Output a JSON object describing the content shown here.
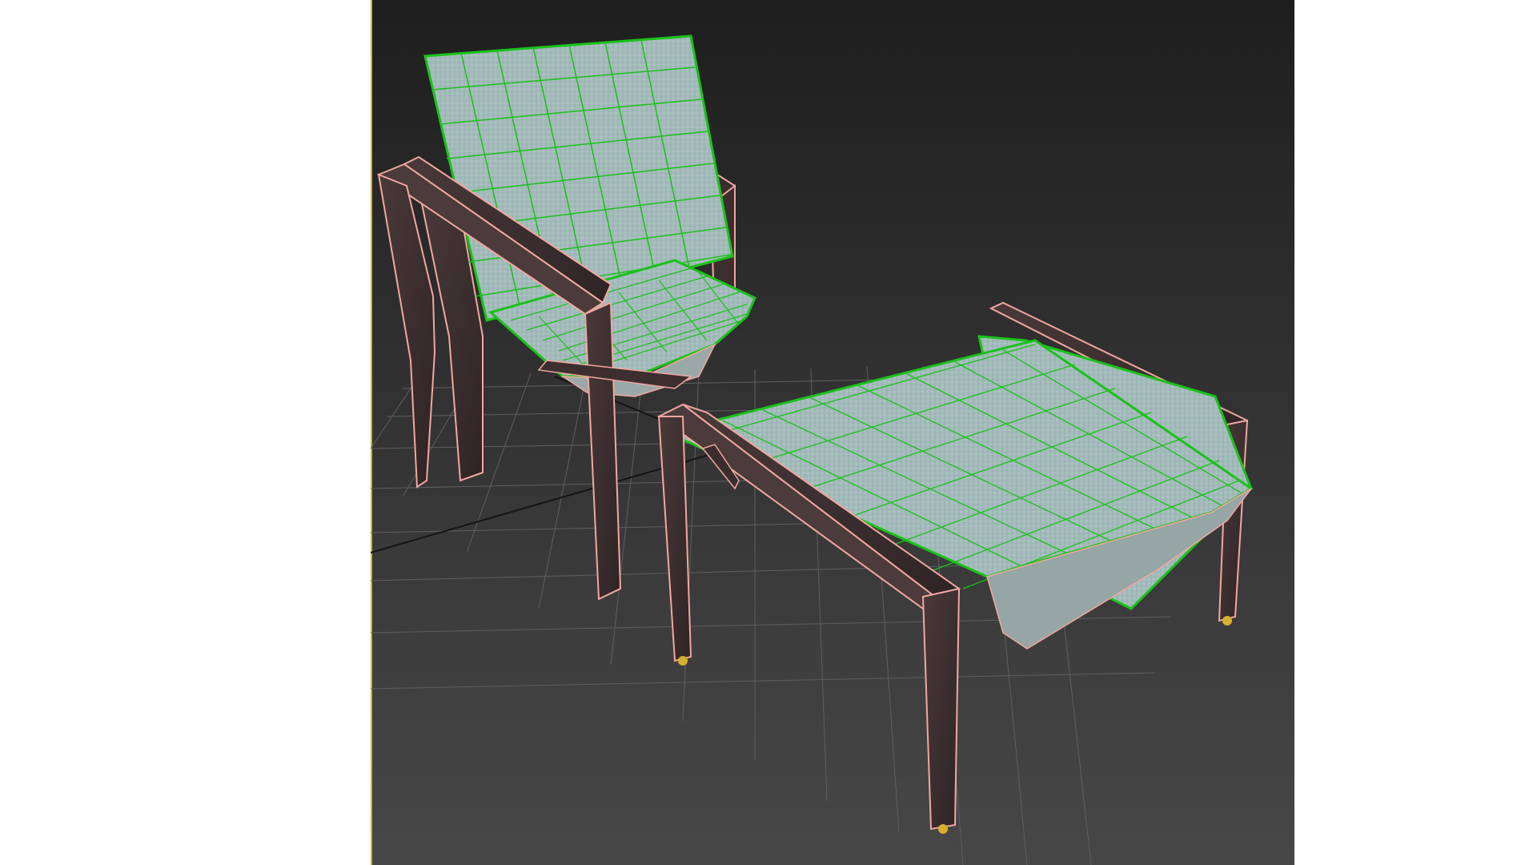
{
  "viewport": {
    "label": "",
    "background_top": "#1e1e1e",
    "background_bottom": "#474747",
    "active_border_color": "#d8b12a"
  },
  "scene": {
    "objects": [
      {
        "name": "chair",
        "wire_color": "#f2a7a0",
        "fabric_wire_color": "#19c219",
        "fabric_color": "#9fb7b7"
      },
      {
        "name": "ottoman",
        "wire_color": "#f2a7a0",
        "fabric_wire_color": "#19c219",
        "fabric_color": "#9fb7b7"
      }
    ],
    "grid_color": "#6a6a6a",
    "grid_axis_color": "#111111",
    "foot_cap_color": "#d7b02b"
  }
}
